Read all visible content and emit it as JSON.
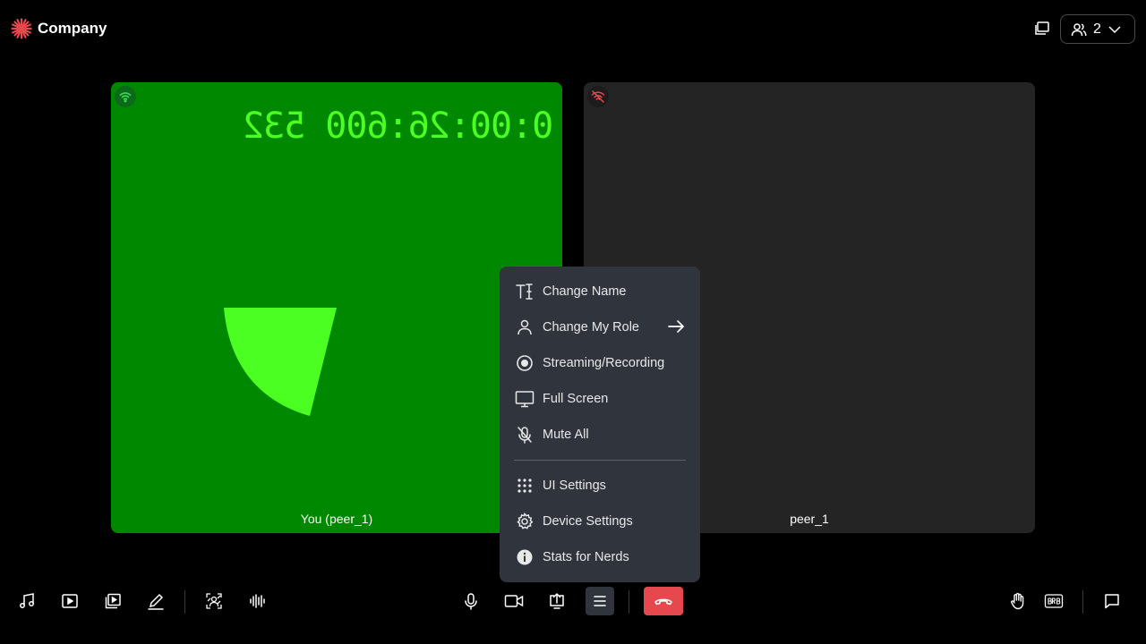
{
  "header": {
    "brand_name": "Company",
    "brand_color": "#e5484d",
    "pip_icon": "picture-in-picture-icon",
    "participants_icon": "people-icon",
    "participants_count": "2"
  },
  "tiles": [
    {
      "name": "You (peer_1)",
      "background": "#008800",
      "network_icon": "wifi-good-icon",
      "timer_text": "0:00:26:600 532"
    },
    {
      "name": "peer_1",
      "background": "#242424",
      "network_icon": "wifi-off-icon"
    }
  ],
  "menu": {
    "items": [
      {
        "label": "Change Name",
        "icon": "text-cursor-icon"
      },
      {
        "label": "Change My Role",
        "icon": "person-icon",
        "trailing_icon": "arrow-right-icon"
      },
      {
        "label": "Streaming/Recording",
        "icon": "record-icon"
      },
      {
        "label": "Full Screen",
        "icon": "monitor-icon"
      },
      {
        "label": "Mute All",
        "icon": "mic-off-icon"
      },
      {
        "label": "UI Settings",
        "icon": "grid-dots-icon"
      },
      {
        "label": "Device Settings",
        "icon": "gear-icon"
      },
      {
        "label": "Stats for Nerds",
        "icon": "info-icon"
      }
    ]
  },
  "toolbar": {
    "left": [
      "music-note-icon",
      "video-play-icon",
      "media-share-icon",
      "pencil-icon",
      "virtual-background-icon",
      "audio-waveform-icon"
    ],
    "center": [
      "microphone-icon",
      "camera-icon",
      "screen-share-icon",
      "hamburger-menu-icon",
      "leave-call-icon"
    ],
    "right": [
      "raise-hand-icon",
      "brb-icon",
      "chat-icon"
    ],
    "leave_color": "#e5484d"
  }
}
